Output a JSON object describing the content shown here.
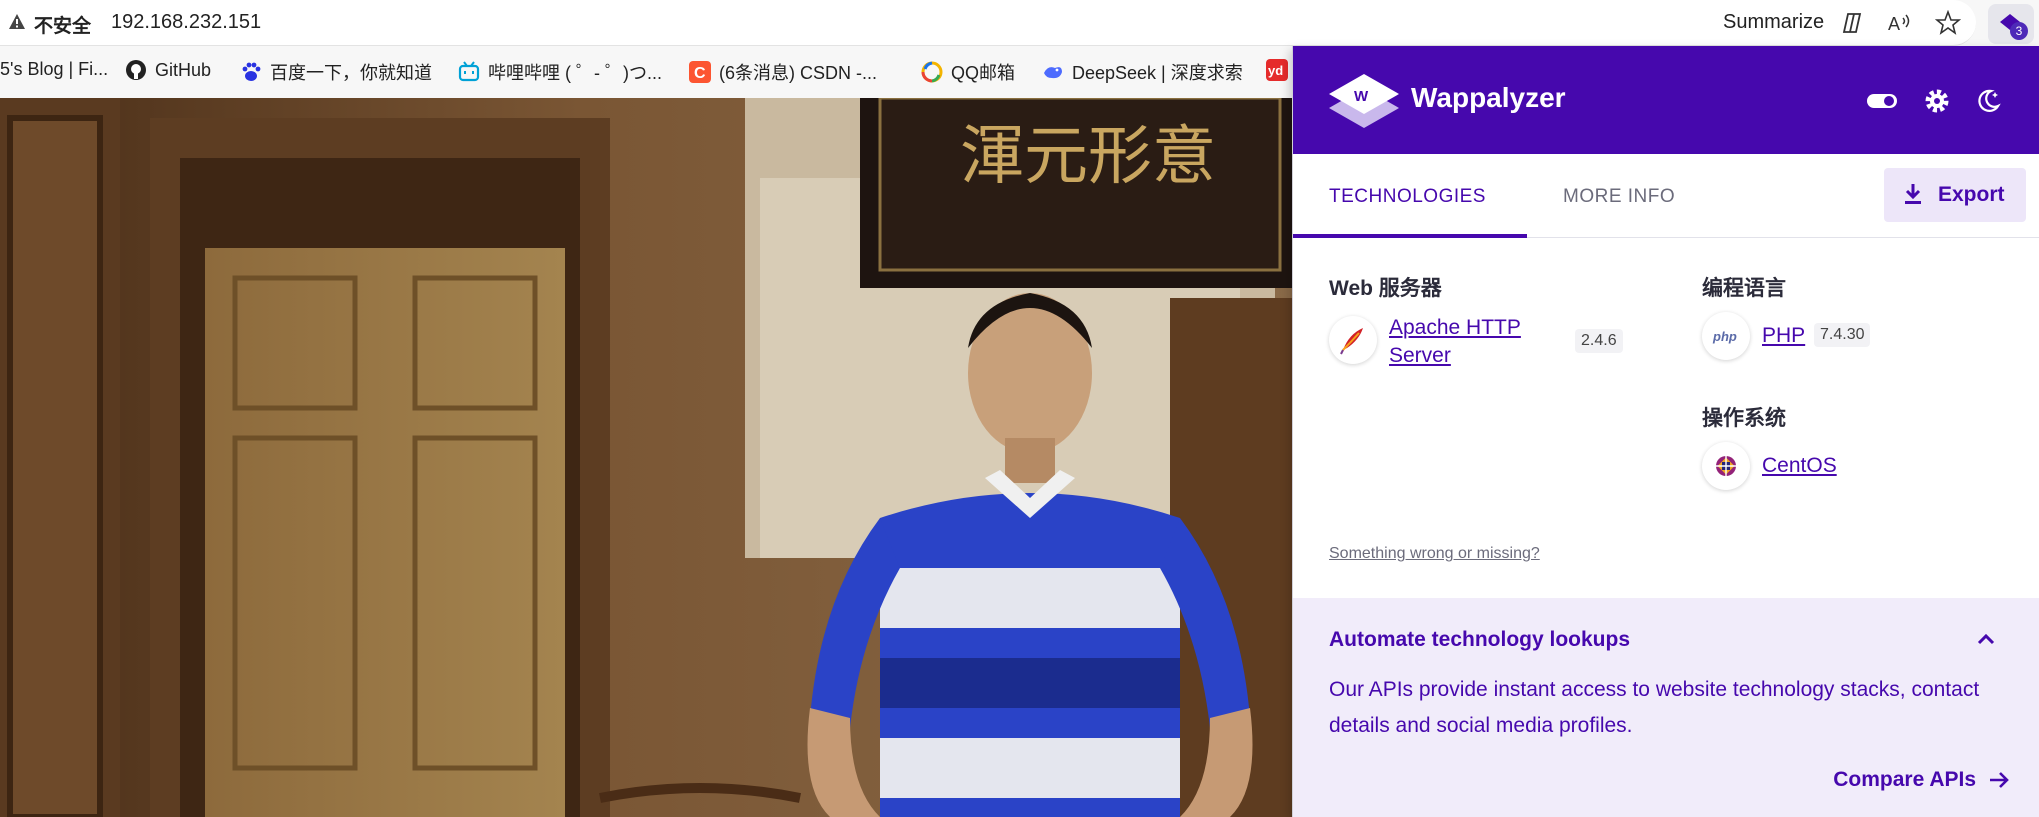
{
  "address_bar": {
    "security_label": "不安全",
    "url": "192.168.232.151",
    "summarize_label": "Summarize",
    "icons": [
      "warning-icon",
      "copilot-icon",
      "read-aloud-icon",
      "favorite-star-icon"
    ],
    "extension_badge": "3"
  },
  "bookmarks": [
    {
      "label": "5's Blog | Fi...",
      "icon": "blog-icon"
    },
    {
      "label": "GitHub",
      "icon": "github-icon"
    },
    {
      "label": "百度一下，你就知道",
      "icon": "baidu-icon"
    },
    {
      "label": "哔哩哔哩 ( ゜- ゜)つ...",
      "icon": "bilibili-icon"
    },
    {
      "label": "(6条消息) CSDN -...",
      "icon": "csdn-icon"
    },
    {
      "label": "QQ邮箱",
      "icon": "qqmail-icon"
    },
    {
      "label": "DeepSeek | 深度求索",
      "icon": "deepseek-icon"
    },
    {
      "label": "",
      "icon": "youdao-icon"
    }
  ],
  "wappalyzer": {
    "brand": "Wappalyzer",
    "header_icons": [
      "toggle-icon",
      "settings-gear-icon",
      "dark-mode-moon-icon"
    ],
    "tabs": [
      {
        "label": "TECHNOLOGIES",
        "active": true
      },
      {
        "label": "MORE INFO",
        "active": false
      }
    ],
    "export_label": "Export",
    "categories": [
      {
        "name": "Web 服务器",
        "items": [
          {
            "name_line1": "Apache HTTP",
            "name_line2": "Server",
            "version": "2.4.6",
            "icon": "apache-feather-icon"
          }
        ]
      },
      {
        "name": "编程语言",
        "items": [
          {
            "name": "PHP",
            "version": "7.4.30",
            "icon": "php-icon"
          }
        ]
      },
      {
        "name": "操作系统",
        "items": [
          {
            "name": "CentOS",
            "icon": "centos-icon"
          }
        ]
      }
    ],
    "feedback_link": "Something wrong or missing?",
    "automate": {
      "title": "Automate technology lookups",
      "description": "Our APIs provide instant access to website technology stacks, contact details and social media profiles.",
      "cta": "Compare APIs"
    },
    "colors": {
      "primary": "#4608ad",
      "light": "#f1ecfa"
    }
  }
}
